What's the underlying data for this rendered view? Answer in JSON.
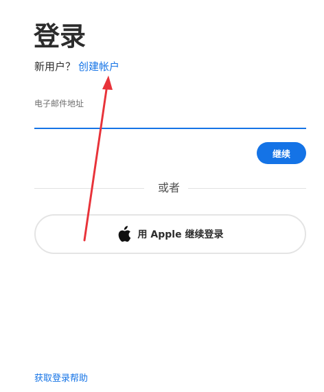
{
  "page": {
    "title": "登录"
  },
  "signup": {
    "prompt": "新用户？",
    "link_label": "创建帐户"
  },
  "email": {
    "label": "电子邮件地址",
    "value": "",
    "placeholder": ""
  },
  "continue_button": {
    "label": "继续"
  },
  "divider": {
    "label": "或者"
  },
  "apple_login": {
    "icon": "apple-icon",
    "label": "用 Apple 继续登录"
  },
  "help": {
    "link_label": "获取登录帮助"
  },
  "colors": {
    "accent": "#1473e6",
    "annotation": "#e8333a"
  }
}
